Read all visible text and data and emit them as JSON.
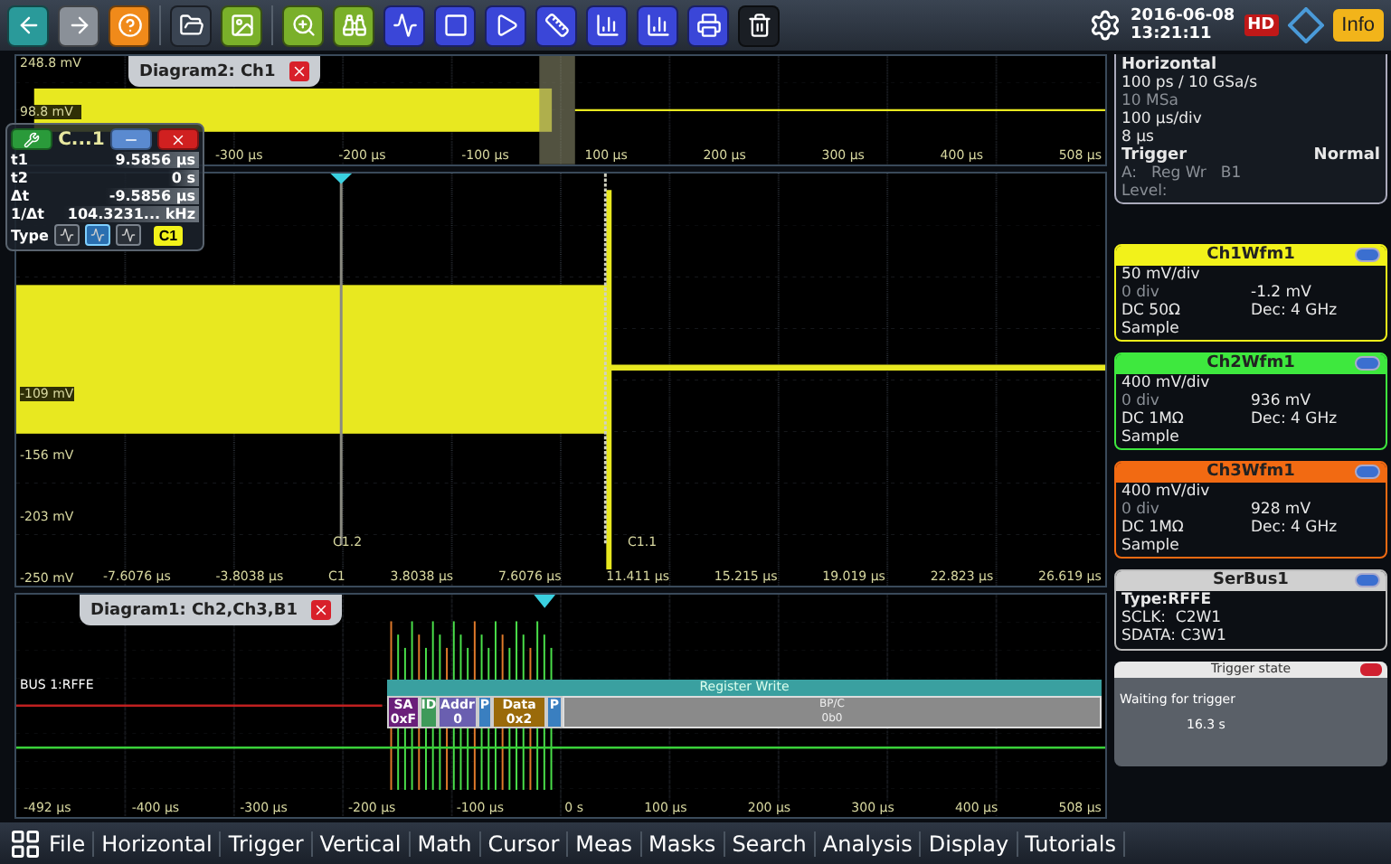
{
  "toolbar": {
    "date": "2016-06-08",
    "time": "13:21:11",
    "hd": "HD",
    "info": "Info"
  },
  "diagram_top": {
    "title": "Diagram2: Ch1",
    "y_labels": [
      "248.8 mV",
      "98.8 mV"
    ],
    "x_labels": [
      "-300 µs",
      "-200 µs",
      "-100 µs",
      "100 µs",
      "200 µs",
      "300 µs",
      "400 µs",
      "508 µs"
    ]
  },
  "cursor_panel": {
    "title": "C...1",
    "rows": [
      {
        "label": "t1",
        "value": "9.5856 µs"
      },
      {
        "label": "t2",
        "value": "0 s"
      },
      {
        "label": "Δt",
        "value": "-9.5856 µs"
      },
      {
        "label": "1/Δt",
        "value": "104.3231... kHz"
      }
    ],
    "type_label": "Type",
    "types": [
      {
        "selected": false
      },
      {
        "selected": true
      },
      {
        "selected": false
      }
    ],
    "source": "C1"
  },
  "diagram_main": {
    "y_labels": [
      "-109 mV",
      "-156 mV",
      "-203 mV",
      "-250 mV"
    ],
    "x_labels": [
      "-7.6076 µs",
      "-3.8038 µs",
      "C1",
      "3.8038 µs",
      "7.6076 µs",
      "11.411 µs",
      "15.215 µs",
      "19.019 µs",
      "22.823 µs",
      "26.619 µs"
    ],
    "cursors": [
      "C1.2",
      "C1.1"
    ]
  },
  "diagram_bus": {
    "title": "Diagram1: Ch2,Ch3,B1",
    "bus_label": "BUS 1:RFFE",
    "frame_title": "Register Write",
    "fields": [
      {
        "label": "SA",
        "value": "0xF",
        "color": "#6a1f7a"
      },
      {
        "label": "ID",
        "color": "#3f9a5a"
      },
      {
        "label": "Addr",
        "value": "0",
        "color": "#6a5fb0"
      },
      {
        "label": "P",
        "color": "#3a7fc0"
      },
      {
        "label": "Data",
        "value": "0x2",
        "color": "#9a6a0a"
      },
      {
        "label": "P",
        "color": "#3a7fc0"
      }
    ],
    "bpc_label": "BP/C",
    "bpc_value": "0b0",
    "x_labels": [
      "-492 µs",
      "-400 µs",
      "-300 µs",
      "-200 µs",
      "-100 µs",
      "0 s",
      "100 µs",
      "200 µs",
      "300 µs",
      "400 µs",
      "508 µs"
    ]
  },
  "horizontal": {
    "title": "Horizontal",
    "lines": [
      "100 ps / 10 GSa/s",
      "10 MSa",
      "100 µs/div",
      "8 µs"
    ]
  },
  "trigger": {
    "title": "Trigger",
    "mode": "Normal",
    "source_label": "A:",
    "source": "Reg Wr",
    "bus": "B1",
    "level_label": "Level:"
  },
  "channels": [
    {
      "name": "Ch1Wfm1",
      "color": "#f2f21a",
      "scale": "50 mV/div",
      "offset": "0 div",
      "value": "-1.2 mV",
      "coupling": "DC 50Ω",
      "dec": "Dec: 4 GHz",
      "mode": "Sample"
    },
    {
      "name": "Ch2Wfm1",
      "color": "#3ee83e",
      "scale": "400 mV/div",
      "offset": "0 div",
      "value": "936 mV",
      "coupling": "DC 1MΩ",
      "dec": "Dec: 4 GHz",
      "mode": "Sample"
    },
    {
      "name": "Ch3Wfm1",
      "color": "#f26a12",
      "scale": "400 mV/div",
      "offset": "0 div",
      "value": "928 mV",
      "coupling": "DC 1MΩ",
      "dec": "Dec: 4 GHz",
      "mode": "Sample"
    }
  ],
  "serbus": {
    "name": "SerBus1",
    "type": "Type:RFFE",
    "lines": [
      "SCLK:  C2W1",
      "SDATA: C3W1"
    ]
  },
  "trigger_state": {
    "title": "Trigger state",
    "message": "Waiting for trigger",
    "elapsed": "16.3 s"
  },
  "menu": [
    "File",
    "Horizontal",
    "Trigger",
    "Vertical",
    "Math",
    "Cursor",
    "Meas",
    "Masks",
    "Search",
    "Analysis",
    "Display",
    "Tutorials"
  ]
}
